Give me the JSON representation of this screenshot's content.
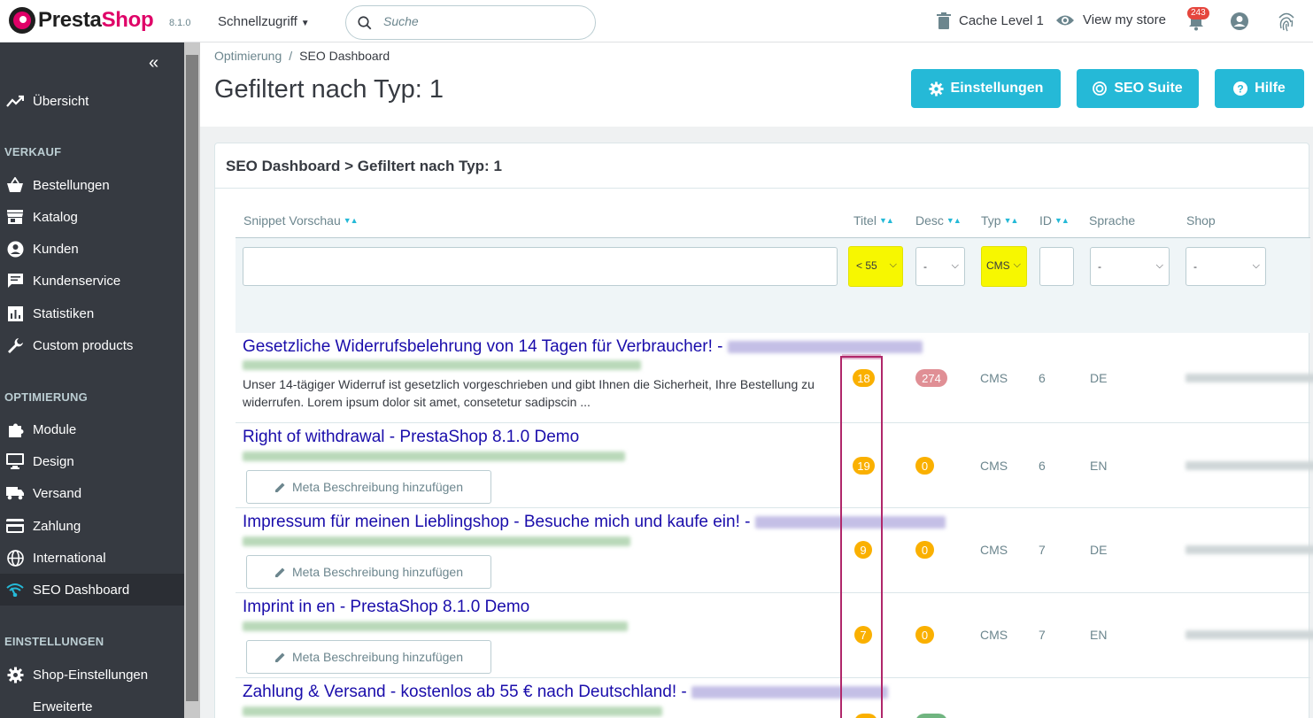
{
  "header": {
    "brand_a": "Presta",
    "brand_b": "Shop",
    "version": "8.1.0",
    "quick_access": "Schnellzugriff",
    "search_placeholder": "Suche",
    "cache_label": "Cache Level 1",
    "view_store": "View my store",
    "notifications_count": "243"
  },
  "sidebar": {
    "items": [
      {
        "label": "Übersicht",
        "icon": "trending-up-icon"
      },
      {
        "label": "Bestellungen",
        "icon": "basket-icon"
      },
      {
        "label": "Katalog",
        "icon": "store-icon"
      },
      {
        "label": "Kunden",
        "icon": "account-circle-icon"
      },
      {
        "label": "Kundenservice",
        "icon": "chat-icon"
      },
      {
        "label": "Statistiken",
        "icon": "bar-chart-icon"
      },
      {
        "label": "Custom products",
        "icon": "wrench-icon"
      },
      {
        "label": "Module",
        "icon": "puzzle-icon"
      },
      {
        "label": "Design",
        "icon": "desktop-icon"
      },
      {
        "label": "Versand",
        "icon": "truck-icon"
      },
      {
        "label": "Zahlung",
        "icon": "credit-card-icon"
      },
      {
        "label": "International",
        "icon": "globe-icon"
      },
      {
        "label": "SEO Dashboard",
        "icon": "wifi-icon"
      },
      {
        "label": "Shop-Einstellungen",
        "icon": "gear-icon"
      },
      {
        "label": "Erweiterte",
        "icon": "gears-icon"
      }
    ],
    "sections": [
      "VERKAUF",
      "OPTIMIERUNG",
      "EINSTELLUNGEN"
    ]
  },
  "page": {
    "breadcrumb_parent": "Optimierung",
    "breadcrumb_sep": "/",
    "breadcrumb_current": "SEO Dashboard",
    "title": "Gefiltert nach Typ: 1",
    "btn_settings": "Einstellungen",
    "btn_seo_suite": "SEO Suite",
    "btn_help": "Hilfe"
  },
  "panel": {
    "title": "SEO Dashboard > Gefiltert nach Typ: 1",
    "columns": [
      "Snippet Vorschau",
      "Titel",
      "Desc",
      "Typ",
      "ID",
      "Sprache",
      "Shop"
    ],
    "filters": {
      "titel": "< 55",
      "desc": "-",
      "typ": "CMS",
      "sprache": "-",
      "shop": "-"
    },
    "meta_button": "Meta Beschreibung hinzufügen",
    "rows": [
      {
        "title": "Gesetzliche Widerrufsbelehrung von 14 Tagen für Verbraucher! -",
        "desc": "Unser 14-tägiger Widerruf ist gesetzlich vorgeschrieben und gibt Ihnen die Sicherheit, Ihre Bestellung zu widerrufen. Lorem ipsum dolor sit amet, consetetur sadipscin ...",
        "titel_len": "18",
        "desc_len": "274",
        "typ": "CMS",
        "id": "6",
        "lang": "DE"
      },
      {
        "title": "Right of withdrawal - PrestaShop 8.1.0 Demo",
        "titel_len": "19",
        "desc_len": "0",
        "typ": "CMS",
        "id": "6",
        "lang": "EN"
      },
      {
        "title": "Impressum für meinen Lieblingshop - Besuche mich und kaufe ein! -",
        "titel_len": "9",
        "desc_len": "0",
        "typ": "CMS",
        "id": "7",
        "lang": "DE"
      },
      {
        "title": "Imprint in en - PrestaShop 8.1.0 Demo",
        "titel_len": "7",
        "desc_len": "0",
        "typ": "CMS",
        "id": "7",
        "lang": "EN"
      },
      {
        "title": "Zahlung & Versand - kostenlos ab 55 € nach Deutschland! -"
      }
    ]
  },
  "colors": {
    "accent": "#25b9d7",
    "brand": "#df0067",
    "sidebar_bg": "#363a41",
    "highlight": "#f7f700",
    "badge_orange": "#fab000",
    "badge_red": "#e08f95"
  }
}
